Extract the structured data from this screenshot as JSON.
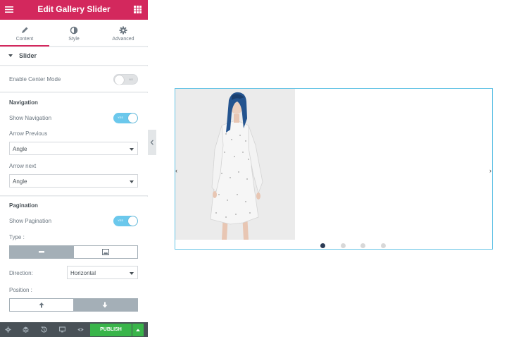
{
  "panel": {
    "title": "Edit Gallery Slider",
    "tabs": [
      {
        "label": "Content",
        "icon": "pencil-icon"
      },
      {
        "label": "Style",
        "icon": "half-circle-icon"
      },
      {
        "label": "Advanced",
        "icon": "gear-icon"
      }
    ],
    "section": {
      "label": "Slider"
    },
    "center_mode": {
      "label": "Enable Center Mode",
      "toggle_text": "NO",
      "enabled": false
    },
    "navigation": {
      "heading": "Navigation",
      "show_label": "Show Navigation",
      "toggle_text": "YES",
      "enabled": true,
      "arrow_prev_label": "Arrow Previous",
      "arrow_prev_value": "Angle",
      "arrow_next_label": "Arrow next",
      "arrow_next_value": "Angle"
    },
    "pagination": {
      "heading": "Pagination",
      "show_label": "Show Pagination",
      "toggle_text": "YES",
      "enabled": true,
      "type_label": "Type :",
      "direction_label": "Direction:",
      "direction_value": "Horizontal",
      "position_label": "Position :"
    },
    "footer": {
      "publish_label": "PUBLISH"
    }
  },
  "colors": {
    "brand": "#d3285d",
    "toggle_on": "#6bc8ec",
    "publish": "#39b54a",
    "footer": "#495157",
    "active_dot": "#2b3b55",
    "slider_border": "#69c5e6"
  },
  "preview": {
    "arrow_prev": "‹",
    "arrow_next": "›",
    "active_page": 1,
    "page_count": 4
  }
}
